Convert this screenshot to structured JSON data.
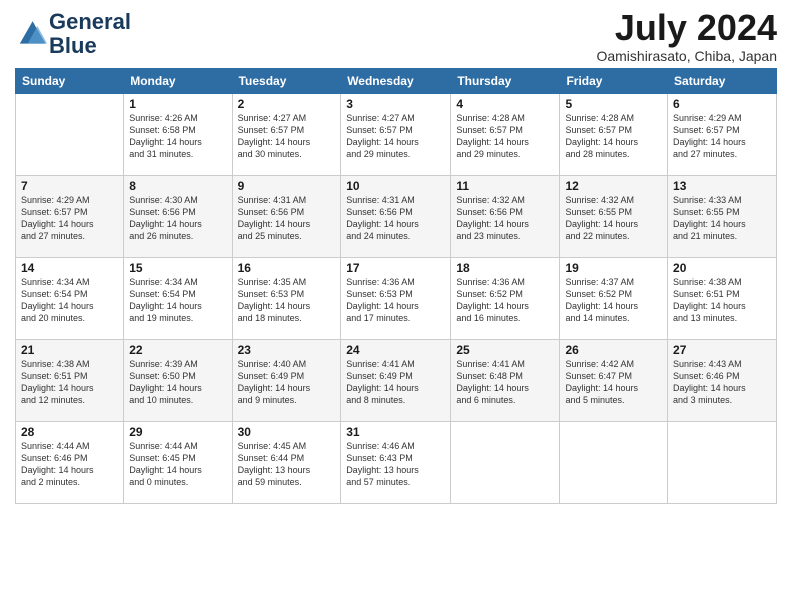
{
  "logo": {
    "line1": "General",
    "line2": "Blue"
  },
  "title": "July 2024",
  "location": "Oamishirasato, Chiba, Japan",
  "days_of_week": [
    "Sunday",
    "Monday",
    "Tuesday",
    "Wednesday",
    "Thursday",
    "Friday",
    "Saturday"
  ],
  "weeks": [
    [
      {
        "day": "",
        "info": ""
      },
      {
        "day": "1",
        "info": "Sunrise: 4:26 AM\nSunset: 6:58 PM\nDaylight: 14 hours\nand 31 minutes."
      },
      {
        "day": "2",
        "info": "Sunrise: 4:27 AM\nSunset: 6:57 PM\nDaylight: 14 hours\nand 30 minutes."
      },
      {
        "day": "3",
        "info": "Sunrise: 4:27 AM\nSunset: 6:57 PM\nDaylight: 14 hours\nand 29 minutes."
      },
      {
        "day": "4",
        "info": "Sunrise: 4:28 AM\nSunset: 6:57 PM\nDaylight: 14 hours\nand 29 minutes."
      },
      {
        "day": "5",
        "info": "Sunrise: 4:28 AM\nSunset: 6:57 PM\nDaylight: 14 hours\nand 28 minutes."
      },
      {
        "day": "6",
        "info": "Sunrise: 4:29 AM\nSunset: 6:57 PM\nDaylight: 14 hours\nand 27 minutes."
      }
    ],
    [
      {
        "day": "7",
        "info": "Sunrise: 4:29 AM\nSunset: 6:57 PM\nDaylight: 14 hours\nand 27 minutes."
      },
      {
        "day": "8",
        "info": "Sunrise: 4:30 AM\nSunset: 6:56 PM\nDaylight: 14 hours\nand 26 minutes."
      },
      {
        "day": "9",
        "info": "Sunrise: 4:31 AM\nSunset: 6:56 PM\nDaylight: 14 hours\nand 25 minutes."
      },
      {
        "day": "10",
        "info": "Sunrise: 4:31 AM\nSunset: 6:56 PM\nDaylight: 14 hours\nand 24 minutes."
      },
      {
        "day": "11",
        "info": "Sunrise: 4:32 AM\nSunset: 6:56 PM\nDaylight: 14 hours\nand 23 minutes."
      },
      {
        "day": "12",
        "info": "Sunrise: 4:32 AM\nSunset: 6:55 PM\nDaylight: 14 hours\nand 22 minutes."
      },
      {
        "day": "13",
        "info": "Sunrise: 4:33 AM\nSunset: 6:55 PM\nDaylight: 14 hours\nand 21 minutes."
      }
    ],
    [
      {
        "day": "14",
        "info": "Sunrise: 4:34 AM\nSunset: 6:54 PM\nDaylight: 14 hours\nand 20 minutes."
      },
      {
        "day": "15",
        "info": "Sunrise: 4:34 AM\nSunset: 6:54 PM\nDaylight: 14 hours\nand 19 minutes."
      },
      {
        "day": "16",
        "info": "Sunrise: 4:35 AM\nSunset: 6:53 PM\nDaylight: 14 hours\nand 18 minutes."
      },
      {
        "day": "17",
        "info": "Sunrise: 4:36 AM\nSunset: 6:53 PM\nDaylight: 14 hours\nand 17 minutes."
      },
      {
        "day": "18",
        "info": "Sunrise: 4:36 AM\nSunset: 6:52 PM\nDaylight: 14 hours\nand 16 minutes."
      },
      {
        "day": "19",
        "info": "Sunrise: 4:37 AM\nSunset: 6:52 PM\nDaylight: 14 hours\nand 14 minutes."
      },
      {
        "day": "20",
        "info": "Sunrise: 4:38 AM\nSunset: 6:51 PM\nDaylight: 14 hours\nand 13 minutes."
      }
    ],
    [
      {
        "day": "21",
        "info": "Sunrise: 4:38 AM\nSunset: 6:51 PM\nDaylight: 14 hours\nand 12 minutes."
      },
      {
        "day": "22",
        "info": "Sunrise: 4:39 AM\nSunset: 6:50 PM\nDaylight: 14 hours\nand 10 minutes."
      },
      {
        "day": "23",
        "info": "Sunrise: 4:40 AM\nSunset: 6:49 PM\nDaylight: 14 hours\nand 9 minutes."
      },
      {
        "day": "24",
        "info": "Sunrise: 4:41 AM\nSunset: 6:49 PM\nDaylight: 14 hours\nand 8 minutes."
      },
      {
        "day": "25",
        "info": "Sunrise: 4:41 AM\nSunset: 6:48 PM\nDaylight: 14 hours\nand 6 minutes."
      },
      {
        "day": "26",
        "info": "Sunrise: 4:42 AM\nSunset: 6:47 PM\nDaylight: 14 hours\nand 5 minutes."
      },
      {
        "day": "27",
        "info": "Sunrise: 4:43 AM\nSunset: 6:46 PM\nDaylight: 14 hours\nand 3 minutes."
      }
    ],
    [
      {
        "day": "28",
        "info": "Sunrise: 4:44 AM\nSunset: 6:46 PM\nDaylight: 14 hours\nand 2 minutes."
      },
      {
        "day": "29",
        "info": "Sunrise: 4:44 AM\nSunset: 6:45 PM\nDaylight: 14 hours\nand 0 minutes."
      },
      {
        "day": "30",
        "info": "Sunrise: 4:45 AM\nSunset: 6:44 PM\nDaylight: 13 hours\nand 59 minutes."
      },
      {
        "day": "31",
        "info": "Sunrise: 4:46 AM\nSunset: 6:43 PM\nDaylight: 13 hours\nand 57 minutes."
      },
      {
        "day": "",
        "info": ""
      },
      {
        "day": "",
        "info": ""
      },
      {
        "day": "",
        "info": ""
      }
    ]
  ]
}
